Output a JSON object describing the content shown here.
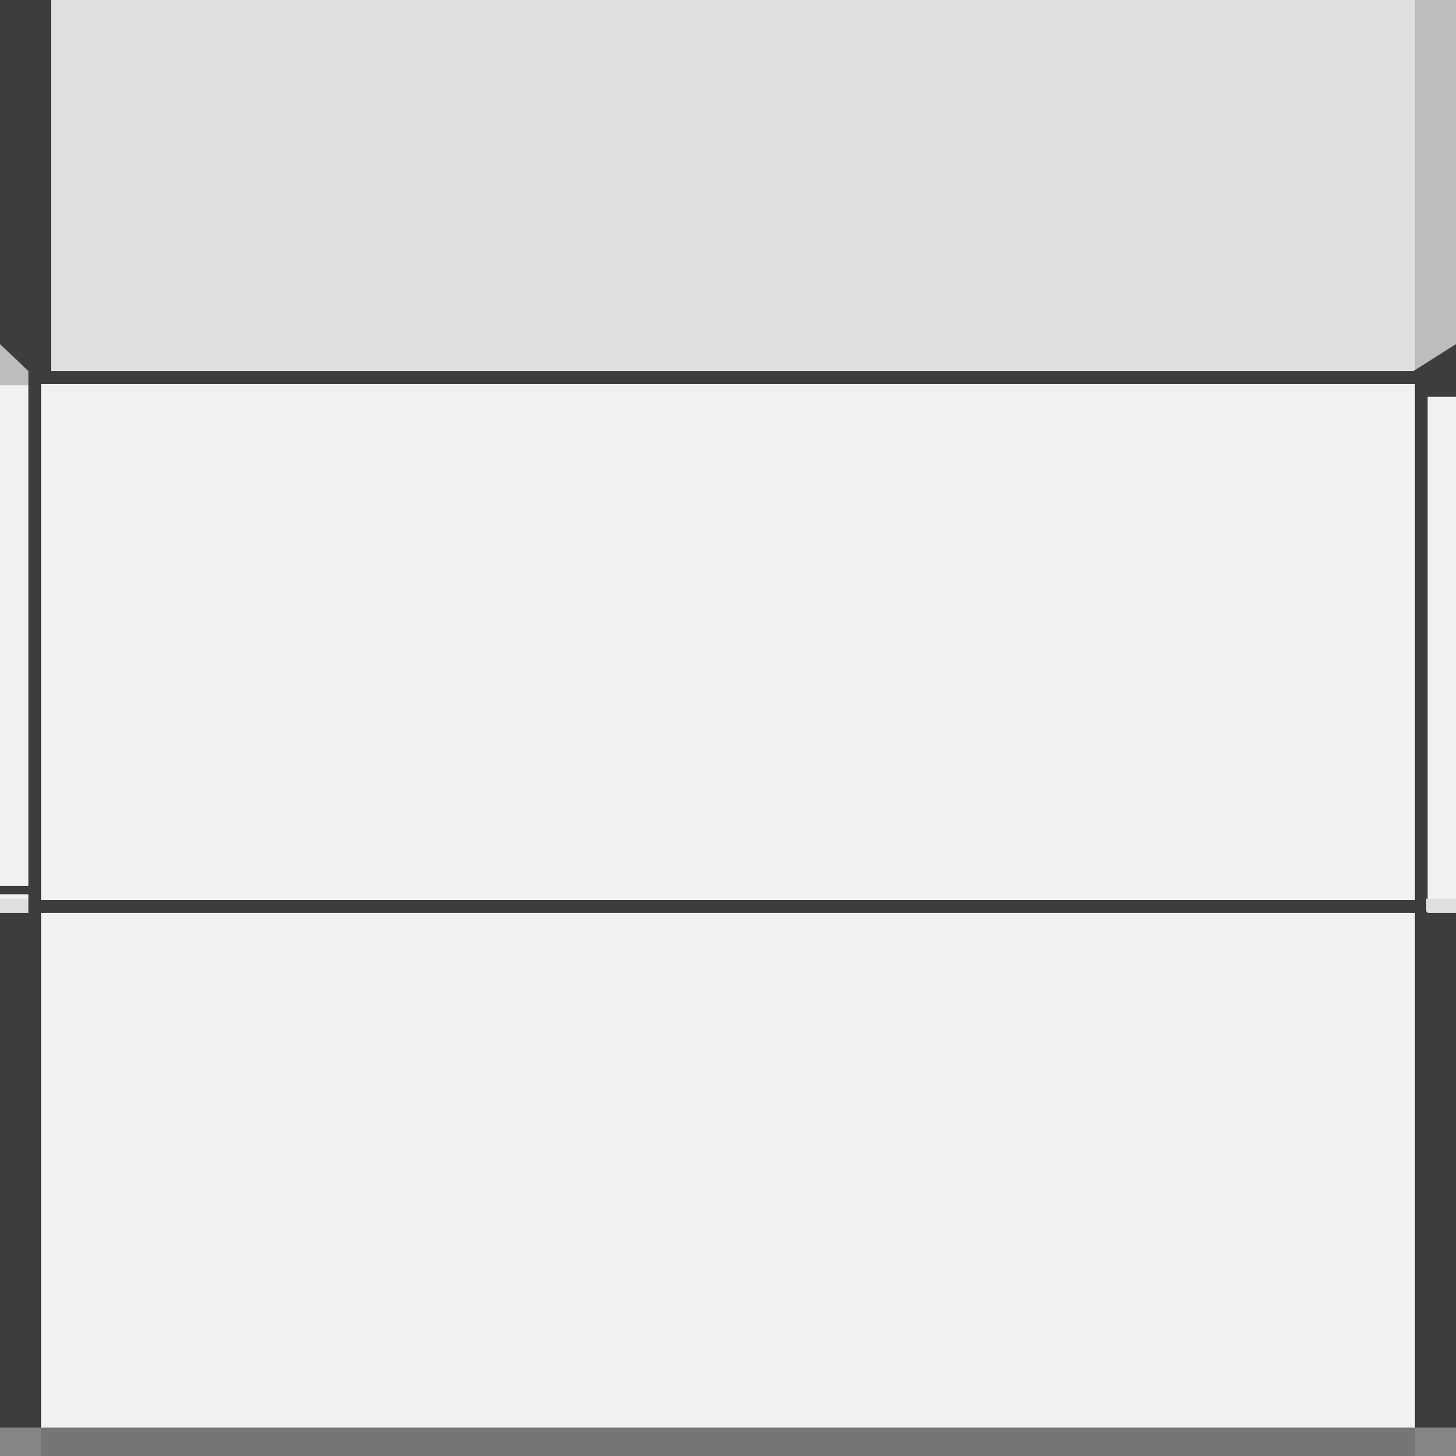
{
  "theme": {
    "top_panel": "#dfdfdf",
    "body_panel": "#f1f1f1",
    "frame": "#3d3d3d",
    "left_strip": "#3d3d3d",
    "right_strip_top": "#bdbdbd",
    "bottom_bar": "#757575",
    "bottom_corner": "#858585",
    "notch_light": "#bdbdbd"
  }
}
